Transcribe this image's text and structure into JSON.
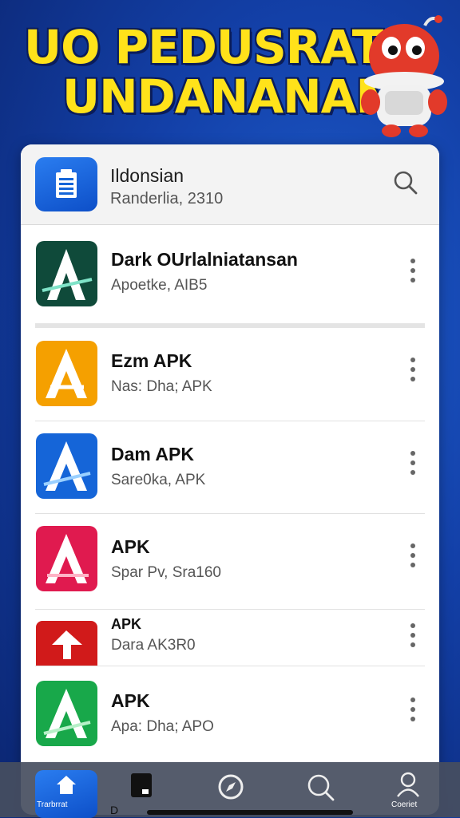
{
  "banner": {
    "line1": "UO PEDUSRAT",
    "line2": "UNDANANAN"
  },
  "header": {
    "title": "Ildonsian",
    "subtitle": "Randerlia, 2310"
  },
  "apps": [
    {
      "name": "Dark OUrlalniatansan",
      "sub": "Apoetke, AIB5",
      "color": "#0f4a3a"
    },
    {
      "name": "Ezm APK",
      "sub": "Nas: Dha; APK",
      "color": "#f5a000"
    },
    {
      "name": "Dam APK",
      "sub": "Sare0ka, APK",
      "color": "#1565d8"
    },
    {
      "name": "APK",
      "sub": "Spar Pv, Sra160",
      "color": "#e01a4f"
    },
    {
      "name": "APK",
      "sub": "Dara AK3R0",
      "color": "#d11a1a"
    },
    {
      "name": "APK",
      "sub": "Apa: Dha; APO",
      "color": "#18a84a"
    }
  ],
  "nav": {
    "home_label": "Trarbrrat",
    "files_label": "D",
    "profile_label": "Coeriet"
  },
  "colors": {
    "banner_text": "#ffe21a",
    "background": "#1340a8",
    "header_icon": "#1565d8"
  }
}
